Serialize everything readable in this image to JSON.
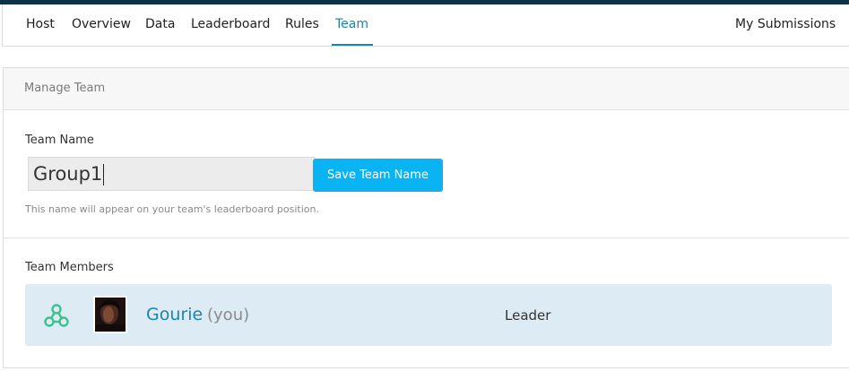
{
  "nav": {
    "items": [
      {
        "label": "Host"
      },
      {
        "label": "Overview"
      },
      {
        "label": "Data"
      },
      {
        "label": "Leaderboard"
      },
      {
        "label": "Rules"
      },
      {
        "label": "Team",
        "active": true
      }
    ],
    "submissions_label": "My Submissions"
  },
  "colors": {
    "accent": "#1a85b0",
    "button": "#0ab4f2",
    "member_row": "#dcebf4",
    "leader_icon": "#3cc08c"
  },
  "card": {
    "title": "Manage Team",
    "team_name_label": "Team Name",
    "team_name_value": "Group1",
    "save_button": "Save Team Name",
    "hint": "This name will appear on your team's leaderboard position.",
    "members_label": "Team Members",
    "members": [
      {
        "name": "Gourie",
        "suffix": "(you)",
        "role": "Leader",
        "icon": "team-leader-icon"
      }
    ]
  }
}
